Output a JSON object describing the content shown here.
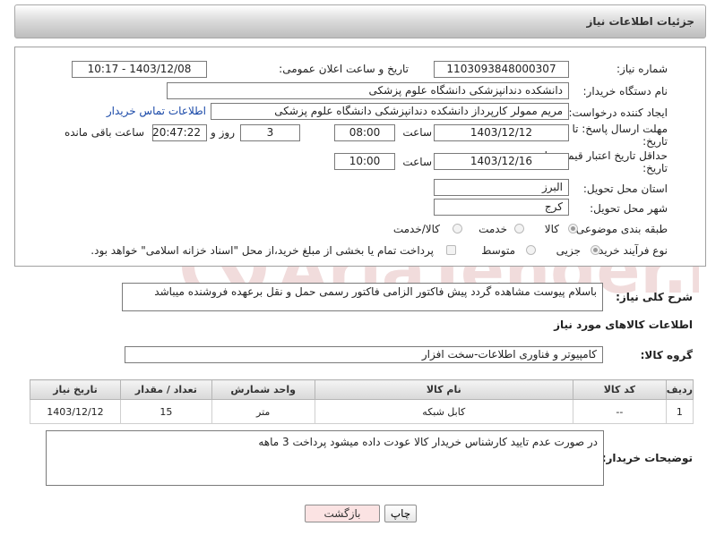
{
  "header": {
    "title": "جزئیات اطلاعات نیاز"
  },
  "form": {
    "need_number_label": "شماره نیاز:",
    "need_number": "1103093848000307",
    "announce_label": "تاریخ و ساعت اعلان عمومی:",
    "announce_value": "1403/12/08 - 10:17",
    "buyer_org_label": "نام دستگاه خریدار:",
    "buyer_org": "دانشکده دندانپزشکی دانشگاه علوم پزشکی",
    "requester_label": "ایجاد کننده درخواست:",
    "requester": "مریم ممولر کارپرداز دانشکده دندانپزشکی دانشگاه علوم پزشکی",
    "contact_link": "اطلاعات تماس خریدار",
    "reply_deadline_label": "مهلت ارسال پاسخ: تا",
    "reply_deadline_label2": "تاریخ:",
    "reply_date": "1403/12/12",
    "time_label": "ساعت",
    "reply_time": "08:00",
    "days": "3",
    "days_and_label": "روز و",
    "remaining_time": "20:47:22",
    "remaining_label": "ساعت باقی مانده",
    "price_validity_label": "حداقل تاریخ اعتبار قیمت: تا",
    "price_validity_label2": "تاریخ:",
    "validity_date": "1403/12/16",
    "validity_time": "10:00",
    "province_label": "استان محل تحویل:",
    "province": "البرز",
    "city_label": "شهر محل تحویل:",
    "city": "کرج",
    "category_label": "طبقه بندی موضوعی:",
    "category_goods": "کالا",
    "category_service": "خدمت",
    "category_goods_service": "کالا/خدمت",
    "process_label": "نوع فرآیند خرید :",
    "process_minor": "جزیی",
    "process_medium": "متوسط",
    "payment_note": "پرداخت تمام یا بخشی از مبلغ خرید،از محل \"اسناد خزانه اسلامی\" خواهد بود."
  },
  "description": {
    "label": "شرح کلی نیاز:",
    "text": "باسلام پیوست مشاهده گردد پیش فاکتور الزامی فاکتور رسمی حمل و نقل برعهده فروشنده میباشد"
  },
  "goods_section": {
    "title": "اطلاعات کالاهای مورد نیاز",
    "group_label": "گروه کالا:",
    "group_value": "کامپیوتر و فناوری اطلاعات-سخت افزار",
    "columns": [
      "ردیف",
      "کد کالا",
      "نام کالا",
      "واحد شمارش",
      "تعداد / مقدار",
      "تاریخ نیاز"
    ],
    "rows": [
      {
        "row": "1",
        "code": "--",
        "name": "کابل شبکه",
        "unit": "متر",
        "qty": "15",
        "date": "1403/12/12"
      }
    ]
  },
  "buyer_notes": {
    "label": "توضیحات خریدار:",
    "text": "در صورت عدم تایید کارشناس خریدار کالا عودت داده میشود پرداخت 3 ماهه"
  },
  "buttons": {
    "print": "چاپ",
    "back": "بازگشت"
  },
  "watermark": {
    "text": "AriaTender.net"
  },
  "colors": {
    "link": "#1a49a8",
    "watermark": "#f1dcdc",
    "back_button_bg": "#fbe3e3"
  }
}
